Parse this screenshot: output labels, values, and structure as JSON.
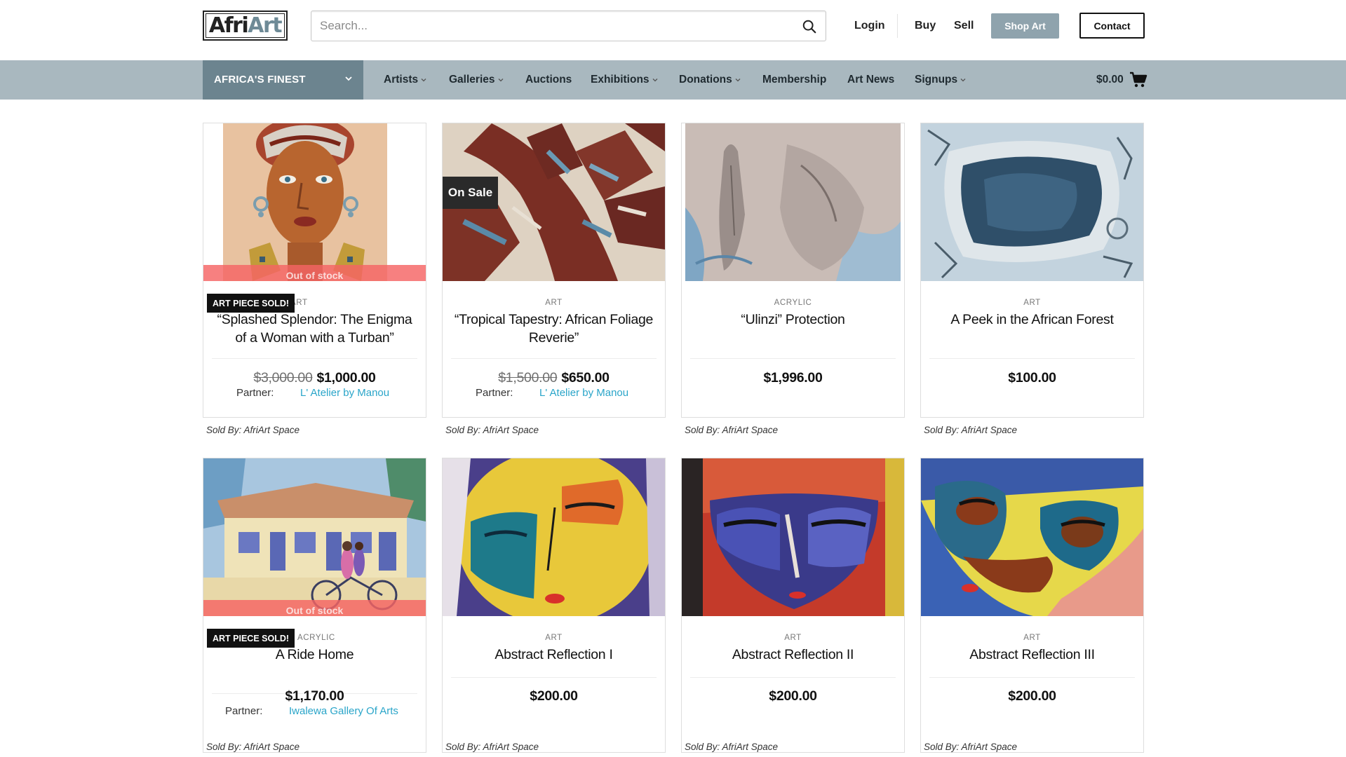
{
  "brand": {
    "logo_part1": "Afri",
    "logo_part2": "Art"
  },
  "search": {
    "placeholder": "Search..."
  },
  "header": {
    "login": "Login",
    "buy": "Buy",
    "sell": "Sell",
    "shop_art": "Shop Art",
    "contact": "Contact"
  },
  "nav": {
    "finest": "AFRICA'S FINEST",
    "items": [
      {
        "label": "Artists",
        "dropdown": true
      },
      {
        "label": "Galleries",
        "dropdown": true
      },
      {
        "label": "Auctions",
        "dropdown": false
      },
      {
        "label": "Exhibitions",
        "dropdown": true
      },
      {
        "label": "Donations",
        "dropdown": true
      },
      {
        "label": "Membership",
        "dropdown": false
      },
      {
        "label": "Art News",
        "dropdown": false
      },
      {
        "label": "Signups",
        "dropdown": true
      }
    ],
    "cart_total": "$0.00"
  },
  "products": [
    {
      "category": "ART",
      "title": "“Splashed Splendor: The Enigma of a Woman with a Turban”",
      "old_price": "$3,000.00",
      "price": "$1,000.00",
      "partner_label": "Partner:",
      "partner": "L' Atelier by Manou",
      "sold_by": "Sold By: AfriArt Space",
      "sold_badge": "ART PIECE SOLD!",
      "out_of_stock": "Out of stock"
    },
    {
      "category": "ART",
      "title": "“Tropical Tapestry: African Foliage Reverie”",
      "old_price": "$1,500.00",
      "price": "$650.00",
      "partner_label": "Partner:",
      "partner": "L' Atelier by Manou",
      "sold_by": "Sold By: AfriArt Space",
      "sale_badge": "On Sale"
    },
    {
      "category": "ACRYLIC",
      "title": "“Ulinzi” Protection",
      "price": "$1,996.00",
      "sold_by": "Sold By: AfriArt Space"
    },
    {
      "category": "ART",
      "title": "A Peek in the African Forest",
      "price": "$100.00",
      "sold_by": "Sold By: AfriArt Space"
    },
    {
      "category": "ACRYLIC",
      "title": "A Ride Home",
      "price": "$1,170.00",
      "partner_label": "Partner:",
      "partner": "Iwalewa Gallery Of Arts",
      "sold_by": "Sold By: AfriArt Space",
      "sold_badge": "ART PIECE SOLD!",
      "out_of_stock": "Out of stock"
    },
    {
      "category": "ART",
      "title": "Abstract Reflection I",
      "price": "$200.00",
      "sold_by": "Sold By: AfriArt Space"
    },
    {
      "category": "ART",
      "title": "Abstract Reflection II",
      "price": "$200.00",
      "sold_by": "Sold By: AfriArt Space"
    },
    {
      "category": "ART",
      "title": "Abstract Reflection III",
      "price": "$200.00",
      "sold_by": "Sold By: AfriArt Space"
    }
  ],
  "colors": {
    "navbar": "#a9b8bf",
    "finest_bg": "#6c848f",
    "shop_button": "#8fa3ad",
    "partner_link": "#2aa5c9",
    "out_of_stock_band": "#f56464"
  }
}
